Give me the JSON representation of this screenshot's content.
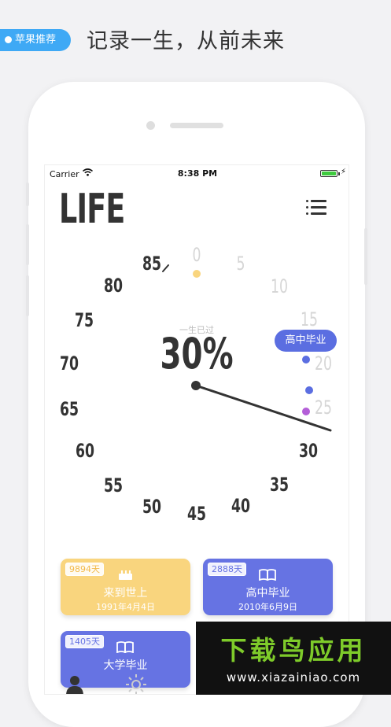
{
  "promo": {
    "badge": "苹果推荐",
    "headline": "记录一生，从前未来"
  },
  "status_bar": {
    "carrier": "Carrier",
    "time": "8:38 PM"
  },
  "app": {
    "title": "LIFE"
  },
  "dial": {
    "ticks": [
      "0",
      "5",
      "10",
      "15",
      "20",
      "25",
      "30",
      "35",
      "40",
      "45",
      "50",
      "55",
      "60",
      "65",
      "70",
      "75",
      "80",
      "85"
    ],
    "elapsed_label": "一生已过",
    "percent": "30%",
    "milestone_bubble": "高中毕业",
    "progress": 0.3,
    "colors": {
      "accent": "#5b6ee1",
      "milestone_yellow": "#f9d57e",
      "milestone_purple": "#b45fd8",
      "hand": "#333333"
    }
  },
  "cards": [
    {
      "days": "9894天",
      "title": "来到世上",
      "date": "1991年4月4日",
      "icon": "cake-icon",
      "color": "#f9d57e"
    },
    {
      "days": "2888天",
      "title": "高中毕业",
      "date": "2010年6月9日",
      "icon": "book-icon",
      "color": "#6673e3"
    },
    {
      "days": "1405天",
      "title": "大学毕业",
      "date": "",
      "icon": "book-icon",
      "color": "#6673e3"
    }
  ],
  "tabbar": {
    "items": [
      {
        "icon": "person-icon"
      },
      {
        "icon": "sun-icon"
      }
    ]
  },
  "watermark": {
    "title": "下载鸟应用",
    "url": "www.xiazainiao.com"
  }
}
